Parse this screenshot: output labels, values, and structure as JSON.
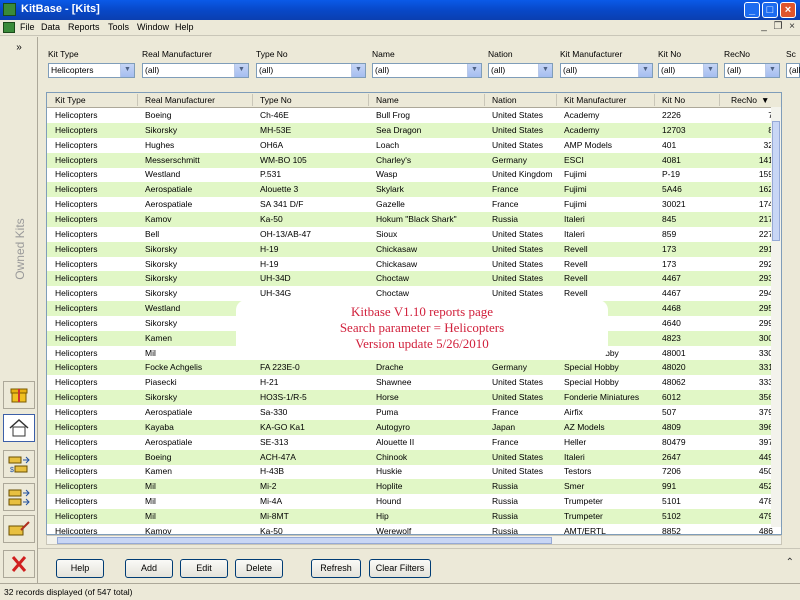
{
  "window": {
    "title": "KitBase - [Kits]"
  },
  "menu": [
    "File",
    "Data",
    "Reports",
    "Tools",
    "Window",
    "Help"
  ],
  "sidebar": {
    "expand_label": "»",
    "panel_label": "Owned Kits"
  },
  "filters": [
    {
      "label": "Kit Type",
      "value": "Helicopters"
    },
    {
      "label": "Real Manufacturer",
      "value": "(all)"
    },
    {
      "label": "Type No",
      "value": "(all)"
    },
    {
      "label": "Name",
      "value": "(all)"
    },
    {
      "label": "Nation",
      "value": "(all)"
    },
    {
      "label": "Kit Manufacturer",
      "value": "(all)"
    },
    {
      "label": "Kit No",
      "value": "(all)"
    },
    {
      "label": "RecNo",
      "value": "(all)"
    },
    {
      "label": "Sc",
      "value": "(all)"
    }
  ],
  "columns": [
    "Kit Type",
    "Real Manufacturer",
    "Type No",
    "Name",
    "Nation",
    "Kit Manufacturer",
    "Kit No",
    "RecNo"
  ],
  "rows": [
    [
      "Helicopters",
      "Boeing",
      "Ch-46E",
      "Bull Frog",
      "United States",
      "Academy",
      "2226",
      "7"
    ],
    [
      "Helicopters",
      "Sikorsky",
      "MH-53E",
      "Sea Dragon",
      "United States",
      "Academy",
      "12703",
      "8"
    ],
    [
      "Helicopters",
      "Hughes",
      "OH6A",
      "Loach",
      "United States",
      "AMP Models",
      "401",
      "32"
    ],
    [
      "Helicopters",
      "Messerschmitt",
      "WM-BO 105",
      "Charley's",
      "Germany",
      "ESCI",
      "4081",
      "141"
    ],
    [
      "Helicopters",
      "Westland",
      "P.531",
      "Wasp",
      "United Kingdom",
      "Fujimi",
      "P-19",
      "159"
    ],
    [
      "Helicopters",
      "Aerospatiale",
      "Alouette 3",
      "Skylark",
      "France",
      "Fujimi",
      "5A46",
      "162"
    ],
    [
      "Helicopters",
      "Aerospatiale",
      "SA 341 D/F",
      "Gazelle",
      "France",
      "Fujimi",
      "30021",
      "174"
    ],
    [
      "Helicopters",
      "Kamov",
      "Ka-50",
      "Hokum \"Black Shark\"",
      "Russia",
      "Italeri",
      "845",
      "217"
    ],
    [
      "Helicopters",
      "Bell",
      "OH-13/AB-47",
      "Sioux",
      "United States",
      "Italeri",
      "859",
      "227"
    ],
    [
      "Helicopters",
      "Sikorsky",
      "H-19",
      "Chickasaw",
      "United States",
      "Revell",
      "173",
      "291"
    ],
    [
      "Helicopters",
      "Sikorsky",
      "H-19",
      "Chickasaw",
      "United States",
      "Revell",
      "173",
      "292"
    ],
    [
      "Helicopters",
      "Sikorsky",
      "UH-34D",
      "Choctaw",
      "United States",
      "Revell",
      "4467",
      "293"
    ],
    [
      "Helicopters",
      "Sikorsky",
      "UH-34G",
      "Choctaw",
      "United States",
      "Revell",
      "4467",
      "294"
    ],
    [
      "Helicopters",
      "Westland",
      "",
      "",
      "",
      "",
      "4468",
      "295"
    ],
    [
      "Helicopters",
      "Sikorsky",
      "",
      "",
      "",
      "",
      "4640",
      "299"
    ],
    [
      "Helicopters",
      "Kamen",
      "",
      "",
      "",
      "",
      "4823",
      "300"
    ],
    [
      "Helicopters",
      "Mil",
      "",
      "",
      "",
      "Special Hobby",
      "48001",
      "330"
    ],
    [
      "Helicopters",
      "Focke Achgelis",
      "FA 223E-0",
      "Drache",
      "Germany",
      "Special Hobby",
      "48020",
      "331"
    ],
    [
      "Helicopters",
      "Piasecki",
      "H-21",
      "Shawnee",
      "United States",
      "Special Hobby",
      "48062",
      "333"
    ],
    [
      "Helicopters",
      "Sikorsky",
      "HO3S-1/R-5",
      "Horse",
      "United States",
      "Fonderie Miniatures",
      "6012",
      "356"
    ],
    [
      "Helicopters",
      "Aerospatiale",
      "Sa-330",
      "Puma",
      "France",
      "Airfix",
      "507",
      "379"
    ],
    [
      "Helicopters",
      "Kayaba",
      "KA-GO Ka1",
      "Autogyro",
      "Japan",
      "AZ Models",
      "4809",
      "396"
    ],
    [
      "Helicopters",
      "Aerospatiale",
      "SE-313",
      "Alouette II",
      "France",
      "Heller",
      "80479",
      "397"
    ],
    [
      "Helicopters",
      "Boeing",
      "ACH-47A",
      "Chinook",
      "United States",
      "Italeri",
      "2647",
      "449"
    ],
    [
      "Helicopters",
      "Kamen",
      "H-43B",
      "Huskie",
      "United States",
      "Testors",
      "7206",
      "450"
    ],
    [
      "Helicopters",
      "Mil",
      "Mi-2",
      "Hoplite",
      "Russia",
      "Smer",
      "991",
      "452"
    ],
    [
      "Helicopters",
      "Mil",
      "Mi-4A",
      "Hound",
      "Russia",
      "Trumpeter",
      "5101",
      "478"
    ],
    [
      "Helicopters",
      "Mil",
      "Mi-8MT",
      "Hip",
      "Russia",
      "Trumpeter",
      "5102",
      "479"
    ],
    [
      "Helicopters",
      "Kamov",
      "Ka-50",
      "Werewolf",
      "Russia",
      "AMT/ERTL",
      "8852",
      "486"
    ]
  ],
  "overlay": {
    "line1": "Kitbase V1.10 reports page",
    "line2": "Search parameter = Helicopters",
    "line3": "Version update 5/26/2010"
  },
  "buttons": {
    "help": "Help",
    "add": "Add",
    "edit": "Edit",
    "delete": "Delete",
    "refresh": "Refresh",
    "clear_filters": "Clear Filters"
  },
  "status": "32 records displayed (of 547 total)",
  "colors": {
    "row_alt": "#e1f7c6",
    "titlebar": "#0a5ae8",
    "overlay_text": "#d1213c"
  }
}
